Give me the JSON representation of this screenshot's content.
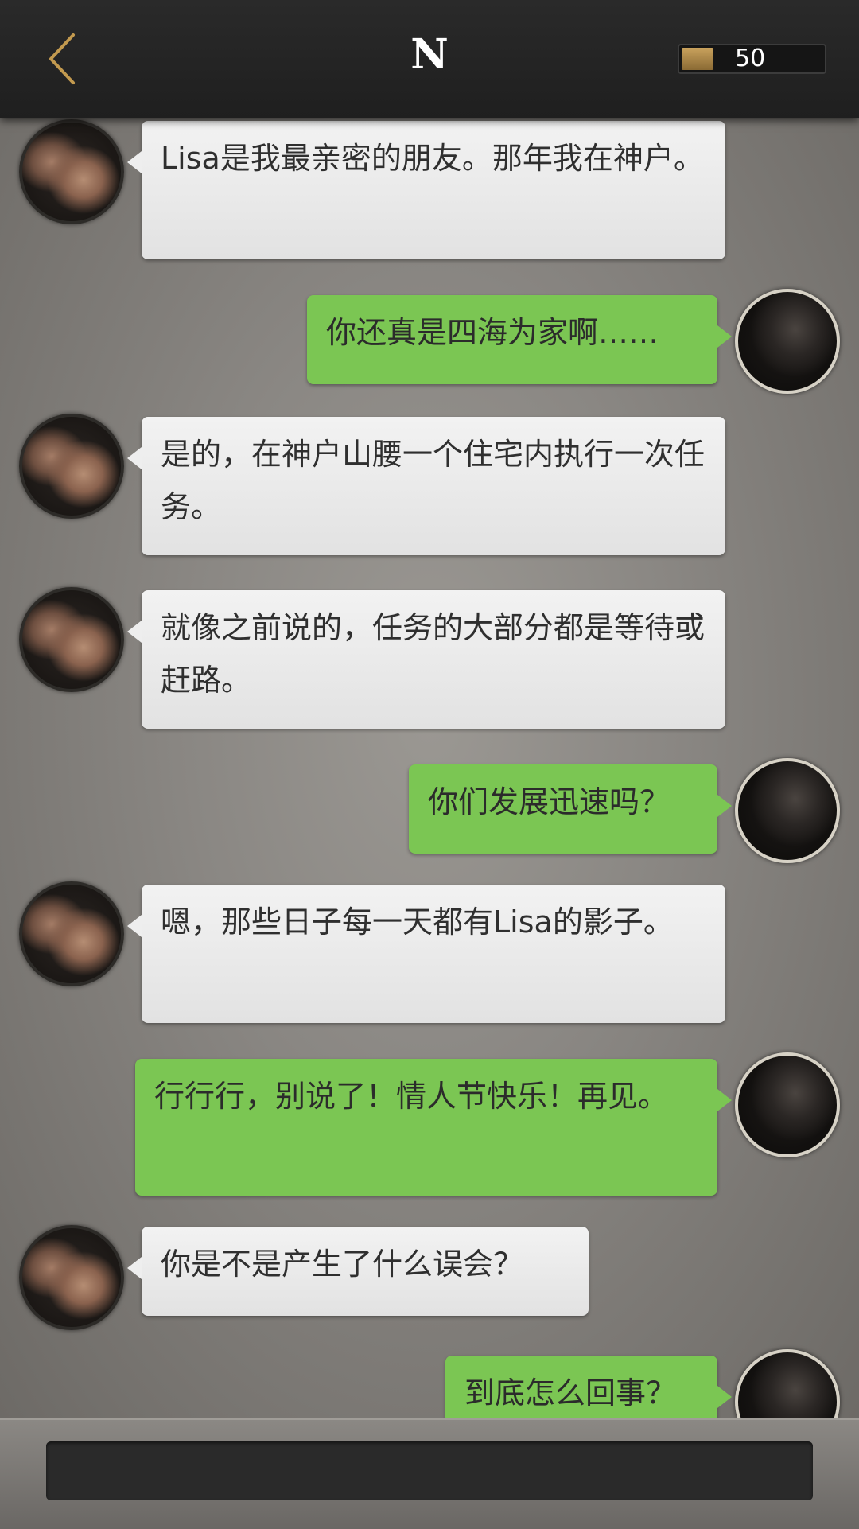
{
  "header": {
    "title": "N",
    "coins": "50",
    "accent_color": "#c9a25d"
  },
  "icons": {
    "back": "chevron-left-icon",
    "coin": "coin-icon"
  },
  "messages": [
    {
      "sender": "npc",
      "text": "Lisa是我最亲密的朋友。那年我在神户。"
    },
    {
      "sender": "player",
      "text": "你还真是四海为家啊……"
    },
    {
      "sender": "npc",
      "text": "是的，在神户山腰一个住宅内执行一次任务。"
    },
    {
      "sender": "npc",
      "text": "就像之前说的，任务的大部分都是等待或赶路。"
    },
    {
      "sender": "player",
      "text": "你们发展迅速吗？"
    },
    {
      "sender": "npc",
      "text": "嗯，那些日子每一天都有Lisa的影子。"
    },
    {
      "sender": "player",
      "text": "行行行，别说了！情人节快乐！再见。"
    },
    {
      "sender": "npc",
      "text": "你是不是产生了什么误会？"
    },
    {
      "sender": "player",
      "text": "到底怎么回事？"
    }
  ],
  "colors": {
    "player_bubble": "#7bc653",
    "npc_bubble": "#eeeeee"
  }
}
